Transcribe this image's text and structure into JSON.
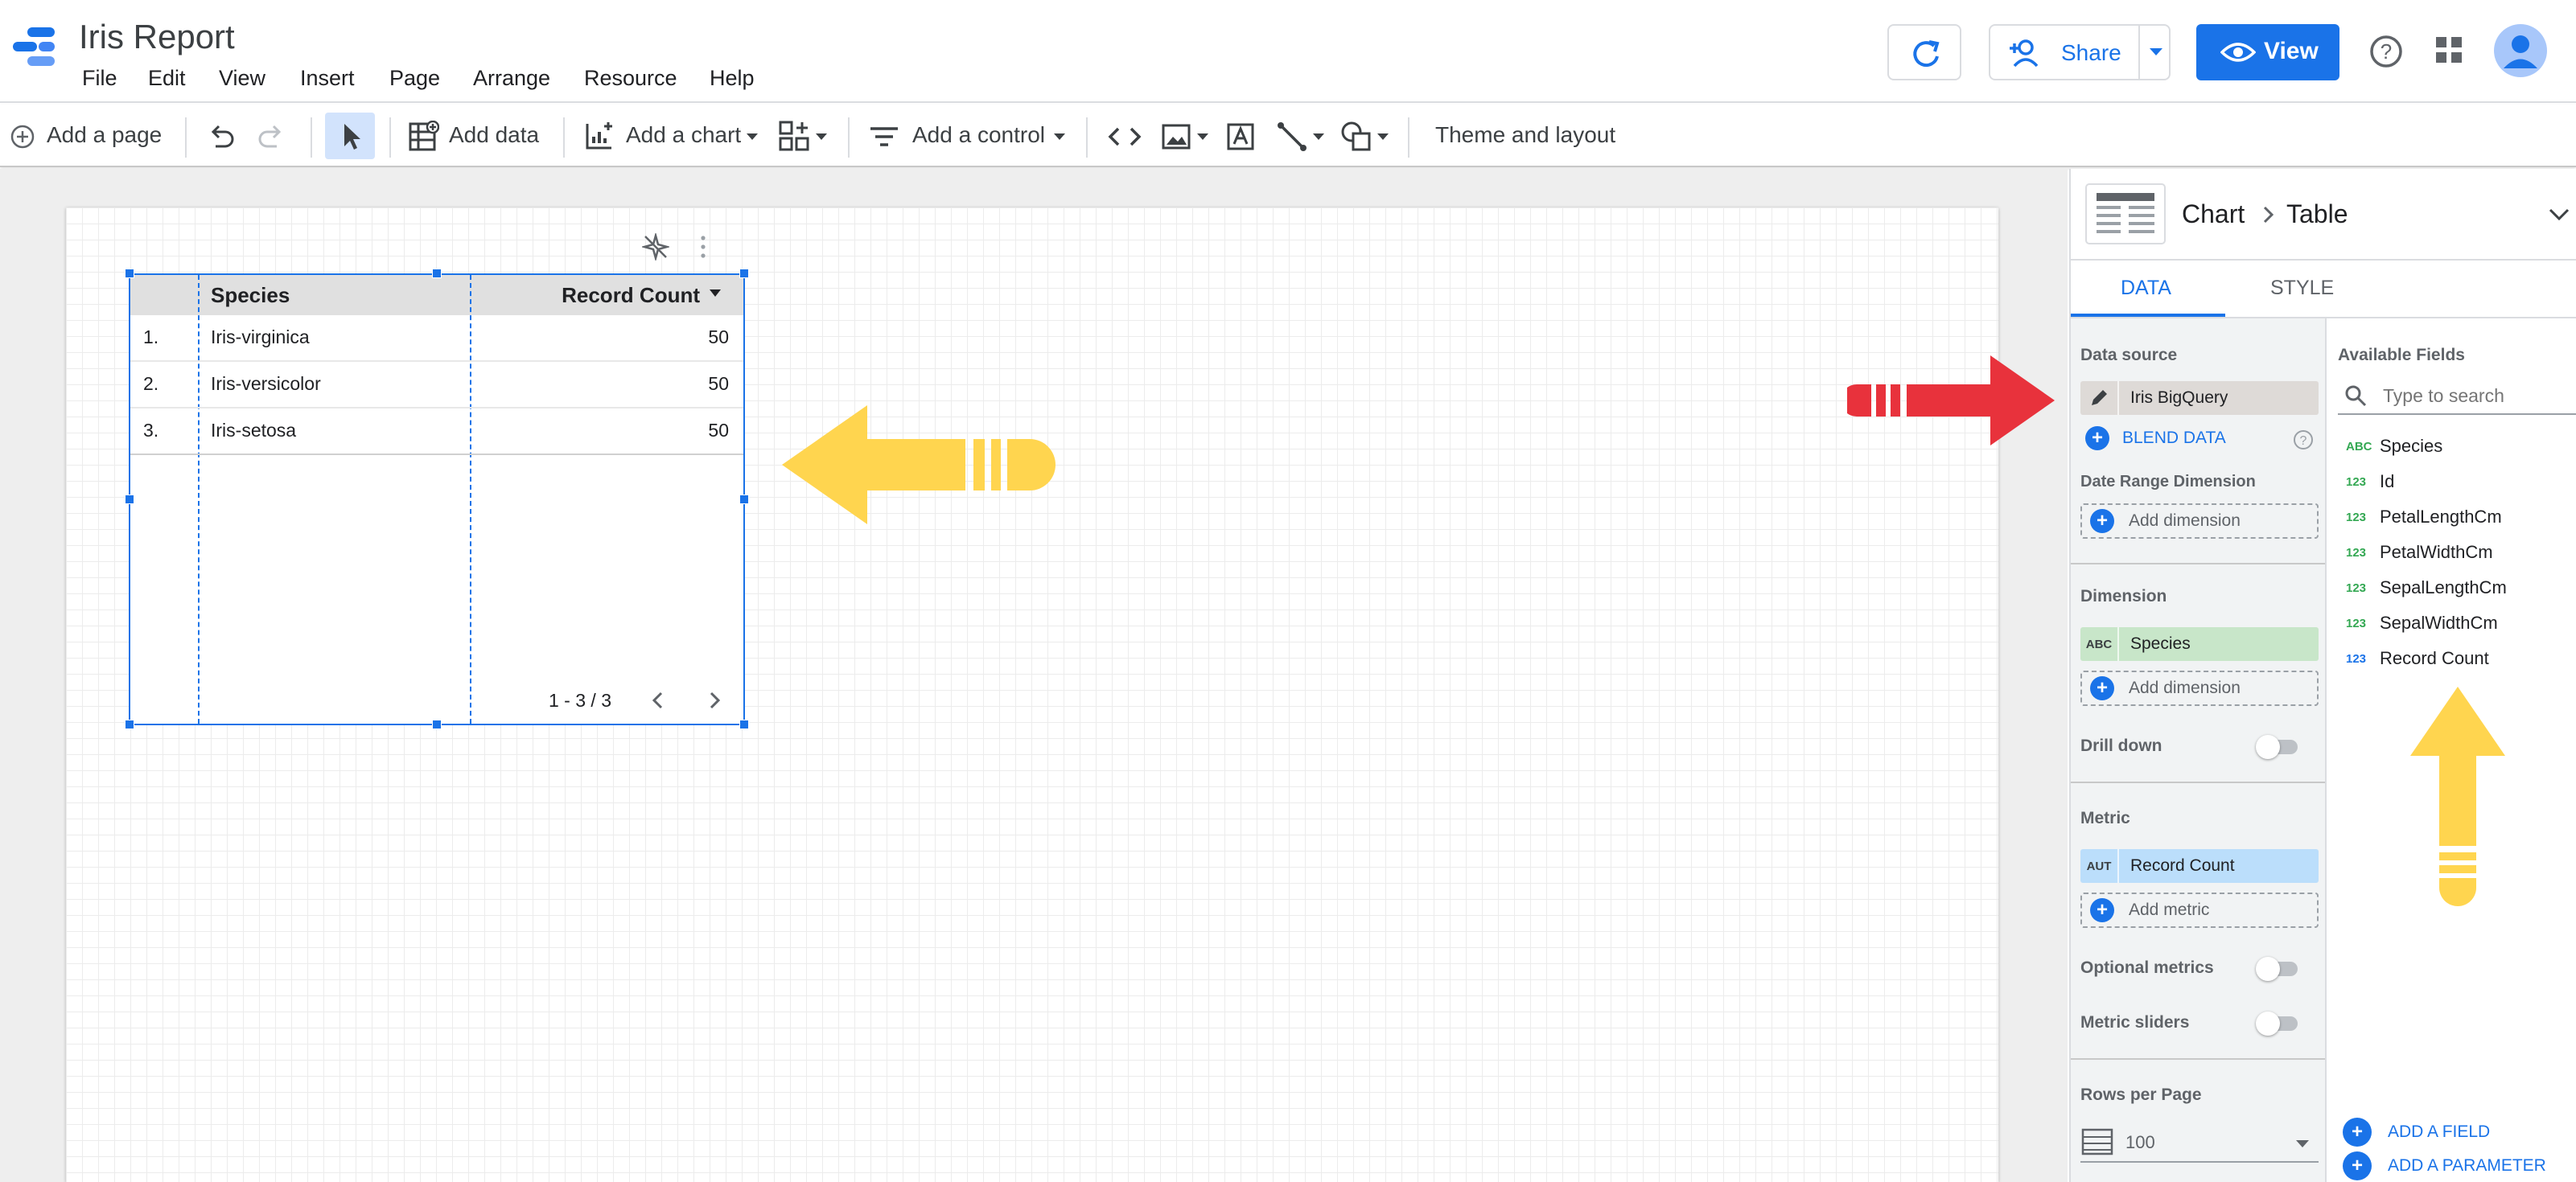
{
  "app": {
    "title": "Iris Report"
  },
  "menu": [
    "File",
    "Edit",
    "View",
    "Insert",
    "Page",
    "Arrange",
    "Resource",
    "Help"
  ],
  "header": {
    "share_label": "Share",
    "view_label": "View"
  },
  "toolbar": {
    "add_page": "Add a page",
    "add_data": "Add data",
    "add_chart": "Add a chart",
    "add_control": "Add a control",
    "theme_layout": "Theme and layout"
  },
  "table": {
    "headers": [
      "Species",
      "Record Count"
    ],
    "rows": [
      {
        "num": "1.",
        "species": "Iris-virginica",
        "count": "50"
      },
      {
        "num": "2.",
        "species": "Iris-versicolor",
        "count": "50"
      },
      {
        "num": "3.",
        "species": "Iris-setosa",
        "count": "50"
      }
    ],
    "pagination": "1 - 3 / 3"
  },
  "panel": {
    "breadcrumb_chart": "Chart",
    "breadcrumb_type": "Table",
    "tabs": [
      "DATA",
      "STYLE"
    ],
    "data_source_label": "Data source",
    "data_source": "Iris BigQuery",
    "blend_label": "BLEND DATA",
    "date_range_label": "Date Range Dimension",
    "add_dimension": "Add dimension",
    "dimension_label": "Dimension",
    "dimension_chip_type": "ABC",
    "dimension_value": "Species",
    "drill_down_label": "Drill down",
    "metric_label": "Metric",
    "metric_chip_type": "AUT",
    "metric_value": "Record Count",
    "add_metric": "Add metric",
    "optional_metrics_label": "Optional metrics",
    "metric_sliders_label": "Metric sliders",
    "rows_per_page_label": "Rows per Page",
    "rows_per_page": "100",
    "available_fields_label": "Available Fields",
    "search_placeholder": "Type to search",
    "fields": [
      {
        "type": "ABC",
        "name": "Species"
      },
      {
        "type": "123",
        "name": "Id"
      },
      {
        "type": "123",
        "name": "PetalLengthCm"
      },
      {
        "type": "123",
        "name": "PetalWidthCm"
      },
      {
        "type": "123",
        "name": "SepalLengthCm"
      },
      {
        "type": "123",
        "name": "SepalWidthCm"
      },
      {
        "type": "123",
        "name": "Record Count"
      }
    ],
    "add_field": "ADD A FIELD",
    "add_parameter": "ADD A PARAMETER"
  },
  "colors": {
    "accent": "#1a73e8",
    "dimension_chip": "#c8e6c9",
    "metric_chip": "#bbdefb",
    "red_arrow": "#e8323c",
    "yellow_arrow": "#ffd54f"
  }
}
